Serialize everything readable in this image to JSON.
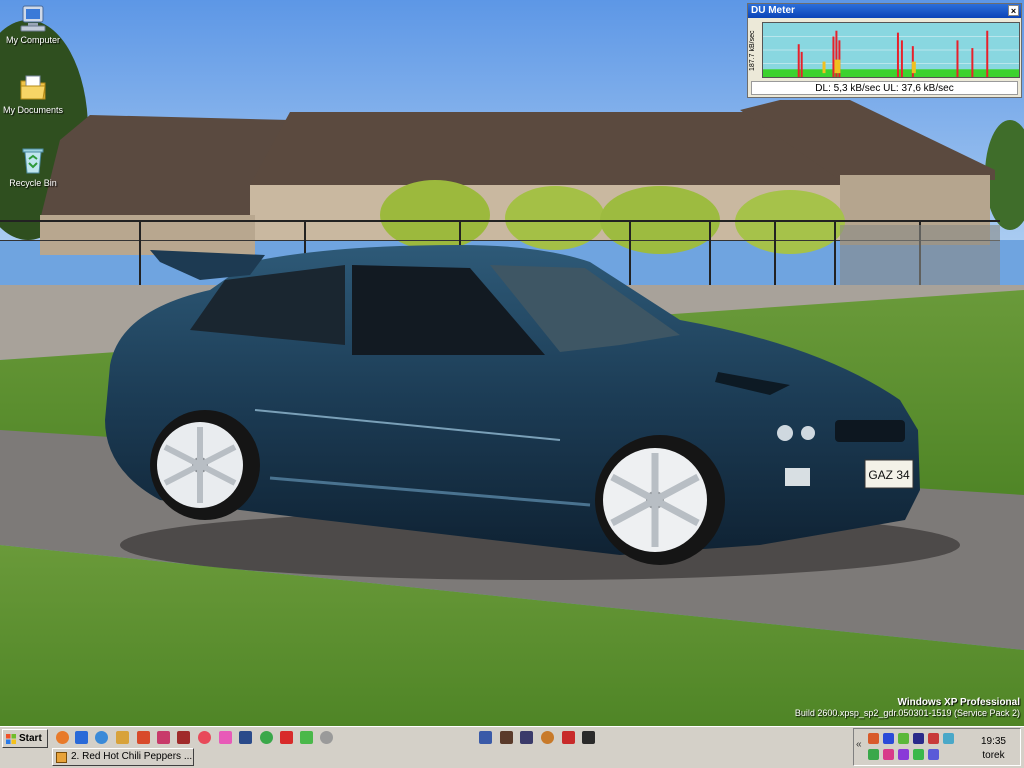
{
  "desktop_icons": [
    {
      "label": "My Computer",
      "icon": "my-computer-icon"
    },
    {
      "label": "My Documents",
      "icon": "my-documents-icon"
    },
    {
      "label": "Recycle Bin",
      "icon": "recycle-bin-icon"
    }
  ],
  "du_meter": {
    "title": "DU Meter",
    "close_glyph": "×",
    "y_axis_label": "187.7 kB/sec",
    "status": "DL: 5,3 kB/sec  UL: 37,6 kB/sec",
    "colors": {
      "background": "#89d7e0",
      "download": "#e8202a",
      "upload": "#3cd22e",
      "overlap": "#f0c020"
    }
  },
  "windows_version": {
    "line1": "Windows XP Professional",
    "line2": "Build 2600.xpsp_sp2_gdr.050301-1519 (Service Pack 2)"
  },
  "taskbar": {
    "start_label": "Start",
    "task_button": "2. Red Hot Chili Peppers ...",
    "tray_chevron": "«",
    "clock_time": "19:35",
    "clock_day": "torek"
  }
}
